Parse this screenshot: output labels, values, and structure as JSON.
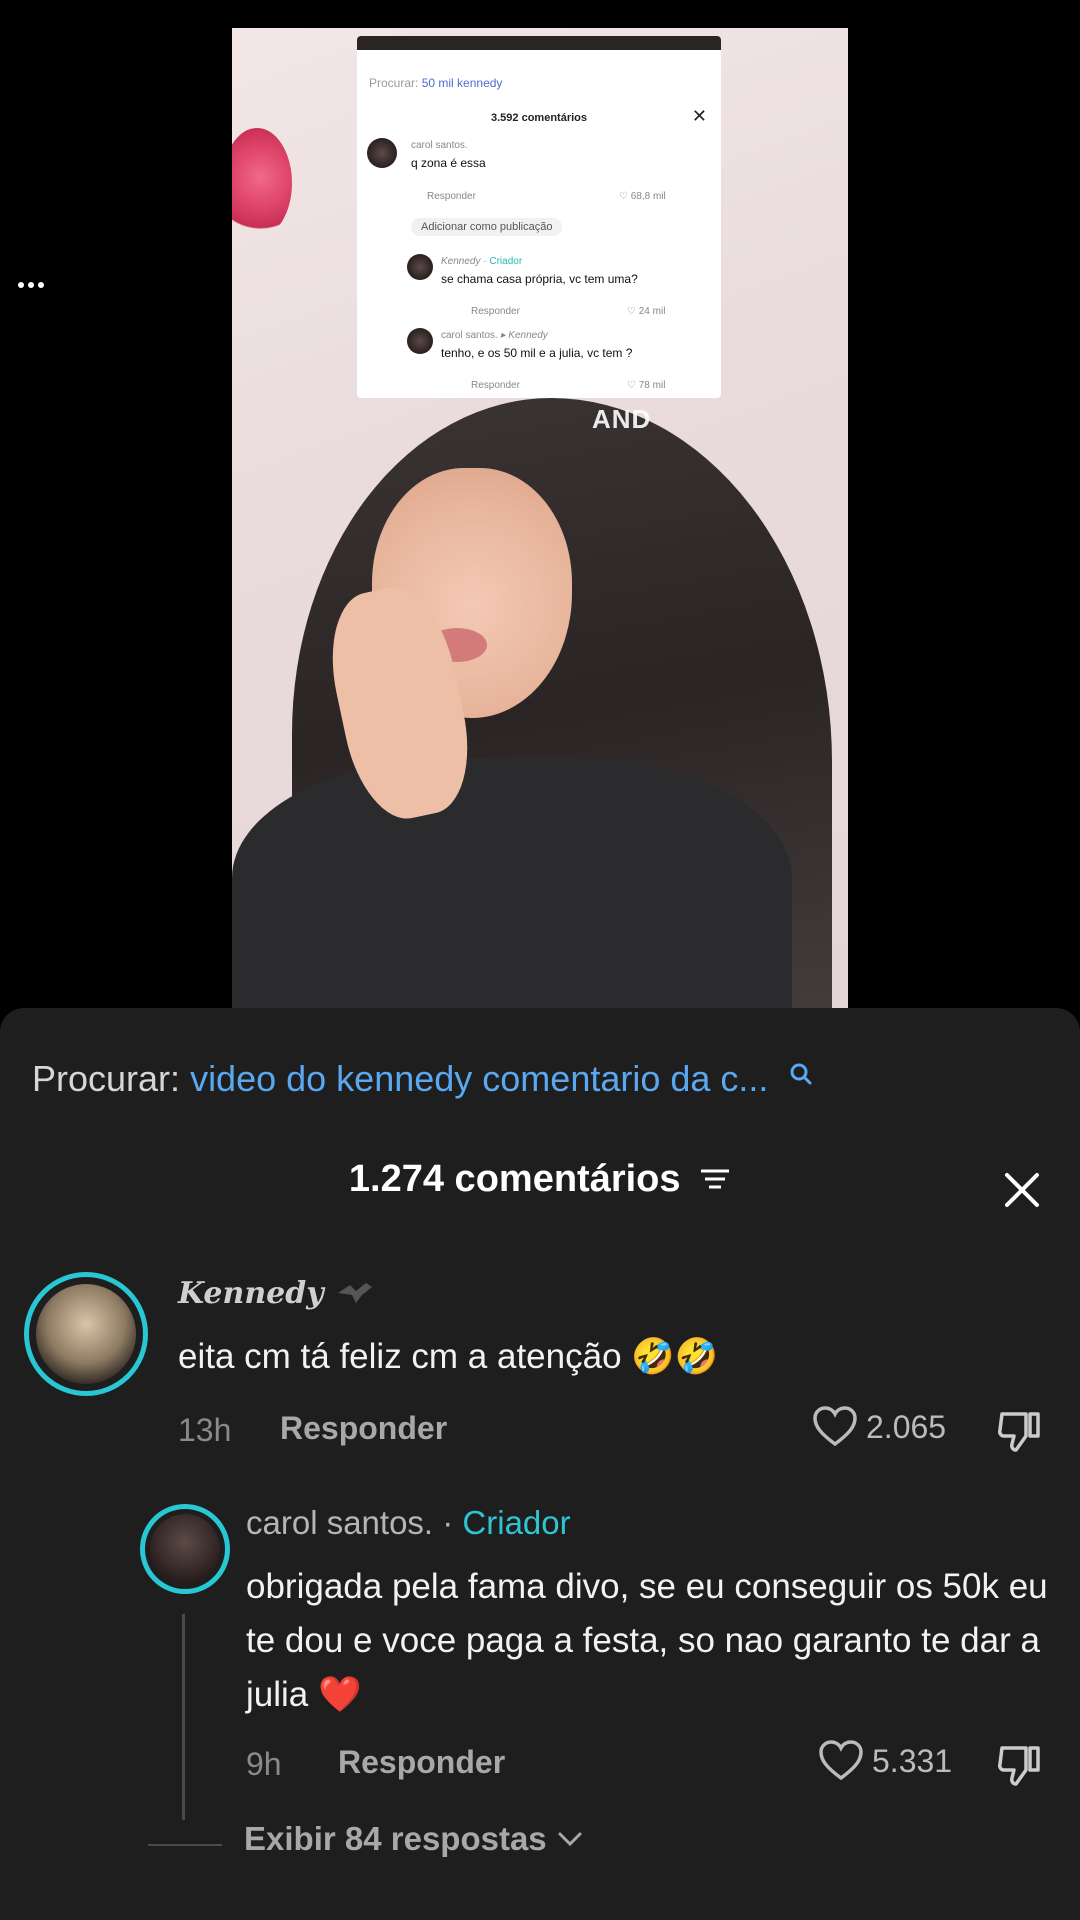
{
  "video": {
    "overlay_text": "AND",
    "embedded_card": {
      "search_label": "Procurar:",
      "search_query": "50 mil kennedy",
      "title": "3.592 comentários",
      "comments": [
        {
          "name": "carol santos.",
          "text": "q zona é essa",
          "reply": "Responder",
          "likes": "68,8 mil"
        },
        {
          "name": "Kennedy",
          "tag": "· Criador",
          "text": "se chama casa própria, vc tem uma?",
          "reply": "Responder",
          "likes": "24 mil"
        },
        {
          "name": "carol santos.",
          "to": "▸ Kennedy",
          "text": "tenho, e os 50 mil e a julia, vc tem ?",
          "reply": "Responder",
          "likes": "78 mil"
        }
      ],
      "add_publication": "Adicionar como publicação"
    }
  },
  "panel": {
    "search_label": "Procurar:",
    "search_query": "video do kennedy comentario da c...",
    "title": "1.274 comentários",
    "comments": [
      {
        "name": "Kennedy",
        "text": "eita cm tá feliz cm a atenção 🤣🤣",
        "time": "13h",
        "reply_label": "Responder",
        "likes": "2.065"
      },
      {
        "name": "carol santos.",
        "separator": " · ",
        "creator_tag": "Criador",
        "text": "obrigada pela fama divo, se eu conseguir os 50k eu te dou e voce paga a festa, so nao garanto te dar a julia ❤️",
        "time": "9h",
        "reply_label": "Responder",
        "likes": "5.331"
      }
    ],
    "show_replies": "Exibir 84 respostas"
  },
  "colors": {
    "panel_bg": "#1e1e1e",
    "accent_link": "#5aa8f0",
    "creator_teal": "#2ec4d1",
    "story_ring": "#29c7d3"
  }
}
